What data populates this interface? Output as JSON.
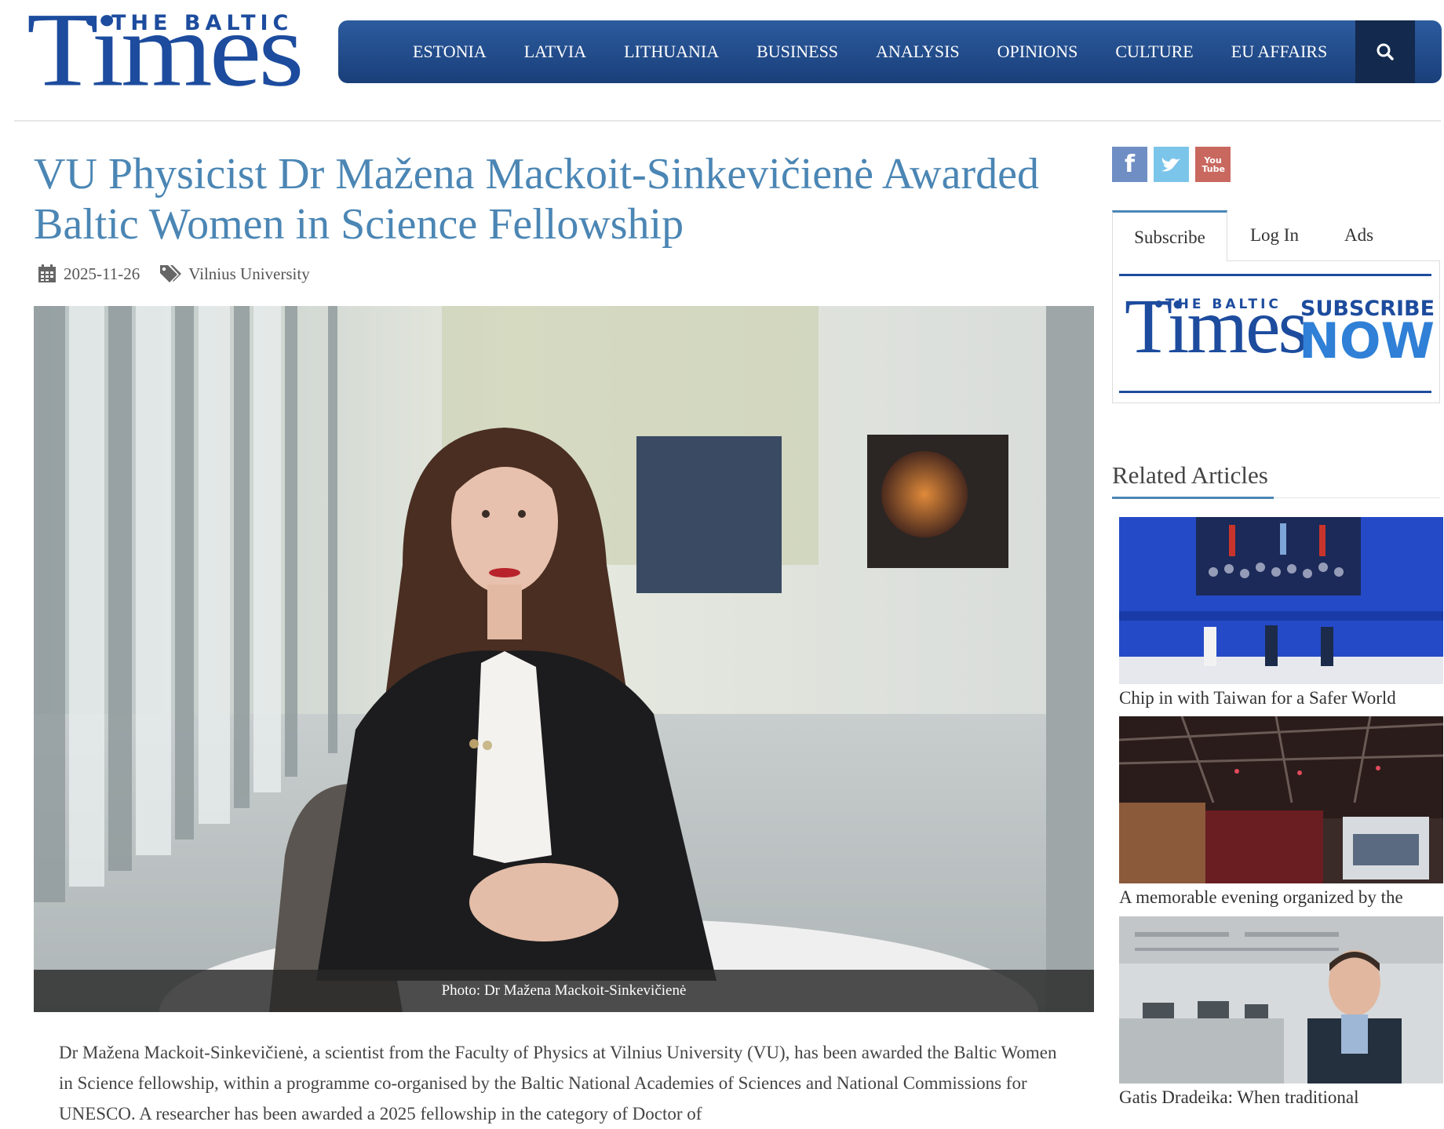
{
  "site": {
    "logo_top": "THE BALTIC",
    "logo_main": "Times"
  },
  "nav": {
    "items": [
      "ESTONIA",
      "LATVIA",
      "LITHUANIA",
      "BUSINESS",
      "ANALYSIS",
      "OPINIONS",
      "CULTURE",
      "EU AFFAIRS"
    ],
    "search_icon": "search-icon"
  },
  "article": {
    "title": "VU Physicist Dr Mažena Mackoit-Sinkevičienė Awarded Baltic Women in Science Fellowship",
    "date": "2025-11-26",
    "tag": "Vilnius University",
    "photo_caption": "Photo: Dr Mažena Mackoit-Sinkevičienė",
    "body": "Dr Mažena Mackoit-Sinkevičienė, a scientist from the Faculty of Physics at Vilnius University (VU), has been awarded the Baltic Women in Science fellowship, within a programme co-organised by the Baltic National Academies of Sciences and National Commissions for UNESCO. A researcher has been awarded a 2025 fellowship in the category of Doctor of"
  },
  "sidebar": {
    "social": [
      {
        "name": "facebook",
        "glyph": "f",
        "color": "#6f8ec4"
      },
      {
        "name": "twitter",
        "glyph": "t",
        "color": "#7cc5ea"
      },
      {
        "name": "youtube",
        "glyph": "You Tube",
        "color": "#c9685f"
      }
    ],
    "tabs": [
      "Subscribe",
      "Log In",
      "Ads"
    ],
    "subscribe_banner": {
      "logo_top": "THE BALTIC",
      "logo_main": "Times",
      "line1": "SUBSCRIBE",
      "line2": "NOW"
    },
    "related_heading": "Related Articles",
    "related": [
      {
        "title": "Chip in with Taiwan for a Safer World"
      },
      {
        "title": "A memorable evening organized by the"
      },
      {
        "title": "Gatis Dradeika: When traditional"
      }
    ]
  },
  "colors": {
    "brand_blue": "#1d4c9e",
    "title_blue": "#4b86b4",
    "nav_dark": "#13294d"
  }
}
